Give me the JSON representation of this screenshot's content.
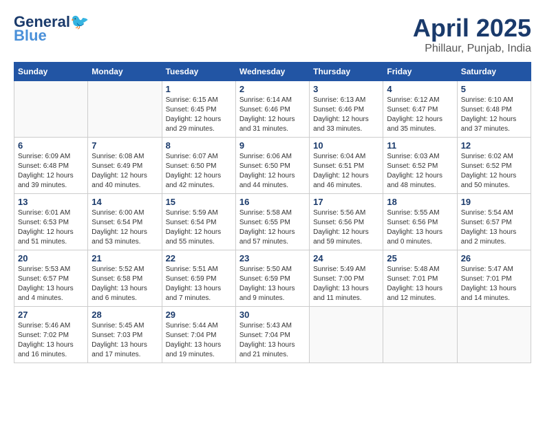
{
  "header": {
    "logo_line1": "General",
    "logo_line2": "Blue",
    "month": "April 2025",
    "location": "Phillaur, Punjab, India"
  },
  "days_of_week": [
    "Sunday",
    "Monday",
    "Tuesday",
    "Wednesday",
    "Thursday",
    "Friday",
    "Saturday"
  ],
  "weeks": [
    [
      {
        "day": "",
        "info": ""
      },
      {
        "day": "",
        "info": ""
      },
      {
        "day": "1",
        "info": "Sunrise: 6:15 AM\nSunset: 6:45 PM\nDaylight: 12 hours\nand 29 minutes."
      },
      {
        "day": "2",
        "info": "Sunrise: 6:14 AM\nSunset: 6:46 PM\nDaylight: 12 hours\nand 31 minutes."
      },
      {
        "day": "3",
        "info": "Sunrise: 6:13 AM\nSunset: 6:46 PM\nDaylight: 12 hours\nand 33 minutes."
      },
      {
        "day": "4",
        "info": "Sunrise: 6:12 AM\nSunset: 6:47 PM\nDaylight: 12 hours\nand 35 minutes."
      },
      {
        "day": "5",
        "info": "Sunrise: 6:10 AM\nSunset: 6:48 PM\nDaylight: 12 hours\nand 37 minutes."
      }
    ],
    [
      {
        "day": "6",
        "info": "Sunrise: 6:09 AM\nSunset: 6:48 PM\nDaylight: 12 hours\nand 39 minutes."
      },
      {
        "day": "7",
        "info": "Sunrise: 6:08 AM\nSunset: 6:49 PM\nDaylight: 12 hours\nand 40 minutes."
      },
      {
        "day": "8",
        "info": "Sunrise: 6:07 AM\nSunset: 6:50 PM\nDaylight: 12 hours\nand 42 minutes."
      },
      {
        "day": "9",
        "info": "Sunrise: 6:06 AM\nSunset: 6:50 PM\nDaylight: 12 hours\nand 44 minutes."
      },
      {
        "day": "10",
        "info": "Sunrise: 6:04 AM\nSunset: 6:51 PM\nDaylight: 12 hours\nand 46 minutes."
      },
      {
        "day": "11",
        "info": "Sunrise: 6:03 AM\nSunset: 6:52 PM\nDaylight: 12 hours\nand 48 minutes."
      },
      {
        "day": "12",
        "info": "Sunrise: 6:02 AM\nSunset: 6:52 PM\nDaylight: 12 hours\nand 50 minutes."
      }
    ],
    [
      {
        "day": "13",
        "info": "Sunrise: 6:01 AM\nSunset: 6:53 PM\nDaylight: 12 hours\nand 51 minutes."
      },
      {
        "day": "14",
        "info": "Sunrise: 6:00 AM\nSunset: 6:54 PM\nDaylight: 12 hours\nand 53 minutes."
      },
      {
        "day": "15",
        "info": "Sunrise: 5:59 AM\nSunset: 6:54 PM\nDaylight: 12 hours\nand 55 minutes."
      },
      {
        "day": "16",
        "info": "Sunrise: 5:58 AM\nSunset: 6:55 PM\nDaylight: 12 hours\nand 57 minutes."
      },
      {
        "day": "17",
        "info": "Sunrise: 5:56 AM\nSunset: 6:56 PM\nDaylight: 12 hours\nand 59 minutes."
      },
      {
        "day": "18",
        "info": "Sunrise: 5:55 AM\nSunset: 6:56 PM\nDaylight: 13 hours\nand 0 minutes."
      },
      {
        "day": "19",
        "info": "Sunrise: 5:54 AM\nSunset: 6:57 PM\nDaylight: 13 hours\nand 2 minutes."
      }
    ],
    [
      {
        "day": "20",
        "info": "Sunrise: 5:53 AM\nSunset: 6:57 PM\nDaylight: 13 hours\nand 4 minutes."
      },
      {
        "day": "21",
        "info": "Sunrise: 5:52 AM\nSunset: 6:58 PM\nDaylight: 13 hours\nand 6 minutes."
      },
      {
        "day": "22",
        "info": "Sunrise: 5:51 AM\nSunset: 6:59 PM\nDaylight: 13 hours\nand 7 minutes."
      },
      {
        "day": "23",
        "info": "Sunrise: 5:50 AM\nSunset: 6:59 PM\nDaylight: 13 hours\nand 9 minutes."
      },
      {
        "day": "24",
        "info": "Sunrise: 5:49 AM\nSunset: 7:00 PM\nDaylight: 13 hours\nand 11 minutes."
      },
      {
        "day": "25",
        "info": "Sunrise: 5:48 AM\nSunset: 7:01 PM\nDaylight: 13 hours\nand 12 minutes."
      },
      {
        "day": "26",
        "info": "Sunrise: 5:47 AM\nSunset: 7:01 PM\nDaylight: 13 hours\nand 14 minutes."
      }
    ],
    [
      {
        "day": "27",
        "info": "Sunrise: 5:46 AM\nSunset: 7:02 PM\nDaylight: 13 hours\nand 16 minutes."
      },
      {
        "day": "28",
        "info": "Sunrise: 5:45 AM\nSunset: 7:03 PM\nDaylight: 13 hours\nand 17 minutes."
      },
      {
        "day": "29",
        "info": "Sunrise: 5:44 AM\nSunset: 7:04 PM\nDaylight: 13 hours\nand 19 minutes."
      },
      {
        "day": "30",
        "info": "Sunrise: 5:43 AM\nSunset: 7:04 PM\nDaylight: 13 hours\nand 21 minutes."
      },
      {
        "day": "",
        "info": ""
      },
      {
        "day": "",
        "info": ""
      },
      {
        "day": "",
        "info": ""
      }
    ]
  ]
}
